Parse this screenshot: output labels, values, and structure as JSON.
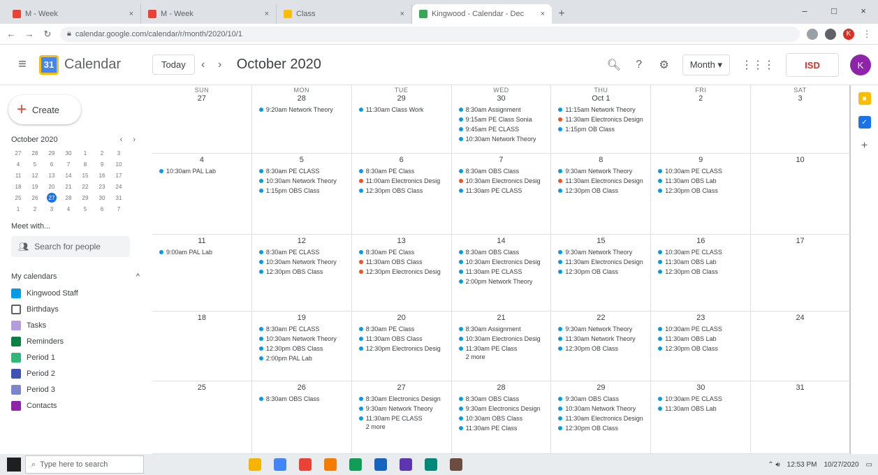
{
  "browser": {
    "tabs": [
      {
        "label": "M - Week",
        "color": "#ea4335",
        "active": false
      },
      {
        "label": "M - Week",
        "color": "#ea4335",
        "active": false
      },
      {
        "label": "Class",
        "color": "#fbbc04",
        "active": false
      },
      {
        "label": "Kingwood - Calendar - Dec",
        "color": "#34a853",
        "active": true
      }
    ],
    "new_tab": "+",
    "url": "calendar.google.com/calendar/r/month/2020/10/1",
    "window_controls": [
      "–",
      "□",
      "×"
    ]
  },
  "header": {
    "app_name": "Calendar",
    "logo_text": "31",
    "today_label": "Today",
    "prev": "‹",
    "next": "›",
    "month_title": "October 2020",
    "view_label": "Month ▾",
    "brand_text": "ISD",
    "avatar_letter": "K",
    "icons": {
      "search": "search-icon",
      "help": "help-icon",
      "settings": "gear-icon",
      "apps": "apps-grid-icon"
    }
  },
  "sidebar": {
    "create_label": "Create",
    "mini_title": "October 2020",
    "mini_arrows": "‹ ›",
    "mini_days": [
      "27",
      "28",
      "29",
      "30",
      "1",
      "2",
      "3",
      "4",
      "5",
      "6",
      "7",
      "8",
      "9",
      "10",
      "11",
      "12",
      "13",
      "14",
      "15",
      "16",
      "17",
      "18",
      "19",
      "20",
      "21",
      "22",
      "23",
      "24",
      "25",
      "26",
      "27",
      "28",
      "29",
      "30",
      "31",
      "1",
      "2",
      "3",
      "4",
      "5",
      "6",
      "7"
    ],
    "meet_label": "Meet with...",
    "search_people": "Search for people",
    "my_calendars": "My calendars",
    "collapse": "^",
    "calendars": [
      {
        "label": "Kingwood Staff",
        "color": "#039be5",
        "checked": true
      },
      {
        "label": "Birthdays",
        "color": "#616161",
        "checked": false
      },
      {
        "label": "Tasks",
        "color": "#b39ddb",
        "checked": true
      },
      {
        "label": "Reminders",
        "color": "#0b8043",
        "checked": true
      },
      {
        "label": "Period 1",
        "color": "#33b679",
        "checked": true
      },
      {
        "label": "Period 2",
        "color": "#3f51b5",
        "checked": true
      },
      {
        "label": "Period 3",
        "color": "#7986cb",
        "checked": true
      },
      {
        "label": "Contacts",
        "color": "#8e24aa",
        "checked": true
      }
    ]
  },
  "calendar": {
    "dow": [
      "SUN",
      "MON",
      "TUE",
      "WED",
      "THU",
      "FRI",
      "SAT"
    ],
    "weeks": [
      [
        {
          "day": "27",
          "events": []
        },
        {
          "day": "28",
          "events": [
            {
              "t": "9:20am Network Theory",
              "c": "#039be5"
            }
          ]
        },
        {
          "day": "29",
          "events": [
            {
              "t": "11:30am Class Work",
              "c": "#039be5"
            }
          ]
        },
        {
          "day": "30",
          "events": [
            {
              "t": "8:30am Assignment",
              "c": "#039be5"
            },
            {
              "t": "9:15am PE Class Sonia",
              "c": "#039be5"
            },
            {
              "t": "9:45am PE CLASS",
              "c": "#039be5"
            },
            {
              "t": "10:30am Network Theory",
              "c": "#039be5"
            }
          ]
        },
        {
          "day": "Oct 1",
          "events": [
            {
              "t": "11:15am Network Theory",
              "c": "#039be5"
            },
            {
              "t": "11:30am Electronics Design",
              "c": "#f4511e"
            },
            {
              "t": "1:15pm OB Class",
              "c": "#039be5"
            }
          ]
        },
        {
          "day": "2",
          "events": []
        },
        {
          "day": "3",
          "events": []
        }
      ],
      [
        {
          "day": "4",
          "events": [
            {
              "t": "10:30am PAL Lab",
              "c": "#039be5"
            }
          ]
        },
        {
          "day": "5",
          "events": [
            {
              "t": "8:30am PE CLASS",
              "c": "#039be5"
            },
            {
              "t": "10:30am Network Theory",
              "c": "#039be5"
            },
            {
              "t": "1:15pm OBS Class",
              "c": "#039be5"
            }
          ]
        },
        {
          "day": "6",
          "events": [
            {
              "t": "8:30am PE Class",
              "c": "#039be5"
            },
            {
              "t": "11:00am Electronics Desig",
              "c": "#f4511e"
            },
            {
              "t": "12:30pm OBS Class",
              "c": "#039be5"
            }
          ]
        },
        {
          "day": "7",
          "events": [
            {
              "t": "8:30am OBS Class",
              "c": "#039be5"
            },
            {
              "t": "10:30am Electronics Desig",
              "c": "#f4511e"
            },
            {
              "t": "11:30am PE CLASS",
              "c": "#039be5"
            }
          ]
        },
        {
          "day": "8",
          "events": [
            {
              "t": "9:30am Network Theory",
              "c": "#039be5"
            },
            {
              "t": "11:30am Electronics Design",
              "c": "#f4511e"
            },
            {
              "t": "12:30pm OB Class",
              "c": "#039be5"
            }
          ]
        },
        {
          "day": "9",
          "events": [
            {
              "t": "10:30am PE CLASS",
              "c": "#039be5"
            },
            {
              "t": "11:30am OBS Lab",
              "c": "#039be5"
            },
            {
              "t": "12:30pm OB Class",
              "c": "#039be5"
            }
          ]
        },
        {
          "day": "10",
          "events": []
        }
      ],
      [
        {
          "day": "11",
          "events": [
            {
              "t": "9:00am PAL Lab",
              "c": "#039be5"
            }
          ]
        },
        {
          "day": "12",
          "events": [
            {
              "t": "8:30am PE CLASS",
              "c": "#039be5"
            },
            {
              "t": "10:30am Network Theory",
              "c": "#039be5"
            },
            {
              "t": "12:30pm OBS Class",
              "c": "#039be5"
            }
          ]
        },
        {
          "day": "13",
          "events": [
            {
              "t": "8:30am PE Class",
              "c": "#039be5"
            },
            {
              "t": "11:30am OBS Class",
              "c": "#f4511e"
            },
            {
              "t": "12:30pm Electronics Desig",
              "c": "#f4511e"
            }
          ]
        },
        {
          "day": "14",
          "events": [
            {
              "t": "8:30am OBS Class",
              "c": "#039be5"
            },
            {
              "t": "10:30am Electronics Desig",
              "c": "#039be5"
            },
            {
              "t": "11:30am PE CLASS",
              "c": "#039be5"
            },
            {
              "t": "2:00pm Network Theory",
              "c": "#039be5"
            }
          ]
        },
        {
          "day": "15",
          "events": [
            {
              "t": "9:30am Network Theory",
              "c": "#039be5"
            },
            {
              "t": "11:30am Electronics Design",
              "c": "#039be5"
            },
            {
              "t": "12:30pm OB Class",
              "c": "#039be5"
            }
          ]
        },
        {
          "day": "16",
          "events": [
            {
              "t": "10:30am PE CLASS",
              "c": "#039be5"
            },
            {
              "t": "11:30am OBS Lab",
              "c": "#039be5"
            },
            {
              "t": "12:30pm OB Class",
              "c": "#039be5"
            }
          ]
        },
        {
          "day": "17",
          "events": []
        }
      ],
      [
        {
          "day": "18",
          "events": []
        },
        {
          "day": "19",
          "events": [
            {
              "t": "8:30am PE CLASS",
              "c": "#039be5"
            },
            {
              "t": "10:30am Network Theory",
              "c": "#039be5"
            },
            {
              "t": "12:30pm OBS Class",
              "c": "#039be5"
            },
            {
              "t": "2:00pm PAL Lab",
              "c": "#039be5"
            }
          ]
        },
        {
          "day": "20",
          "events": [
            {
              "t": "8:30am PE Class",
              "c": "#039be5"
            },
            {
              "t": "11:30am OBS Class",
              "c": "#039be5"
            },
            {
              "t": "12:30pm Electronics Desig",
              "c": "#039be5"
            }
          ]
        },
        {
          "day": "21",
          "events": [
            {
              "t": "8:30am Assignment",
              "c": "#039be5"
            },
            {
              "t": "10:30am Electronics Desig",
              "c": "#039be5"
            },
            {
              "t": "11:30am PE Class",
              "c": "#039be5"
            }
          ],
          "extra": "2 more"
        },
        {
          "day": "22",
          "events": [
            {
              "t": "9:30am Network Theory",
              "c": "#039be5"
            },
            {
              "t": "11:30am Network Theory",
              "c": "#039be5"
            },
            {
              "t": "12:30pm OB Class",
              "c": "#039be5"
            }
          ]
        },
        {
          "day": "23",
          "events": [
            {
              "t": "10:30am PE CLASS",
              "c": "#039be5"
            },
            {
              "t": "11:30am OBS Lab",
              "c": "#039be5"
            },
            {
              "t": "12:30pm OB Class",
              "c": "#039be5"
            }
          ]
        },
        {
          "day": "24",
          "events": []
        }
      ],
      [
        {
          "day": "25",
          "events": []
        },
        {
          "day": "26",
          "events": [
            {
              "t": "8:30am OBS Class",
              "c": "#039be5"
            }
          ]
        },
        {
          "day": "27",
          "events": [
            {
              "t": "8:30am Electronics Design",
              "c": "#039be5"
            },
            {
              "t": "9:30am Network Theory",
              "c": "#039be5"
            },
            {
              "t": "11:30am PE CLASS",
              "c": "#039be5"
            }
          ],
          "extra": "2 more"
        },
        {
          "day": "28",
          "events": [
            {
              "t": "8:30am OBS Class",
              "c": "#039be5"
            },
            {
              "t": "9:30am Electronics Design",
              "c": "#039be5"
            },
            {
              "t": "10:30am OBS Class",
              "c": "#039be5"
            },
            {
              "t": "11:30am PE Class",
              "c": "#039be5"
            }
          ]
        },
        {
          "day": "29",
          "events": [
            {
              "t": "9:30am OBS Class",
              "c": "#039be5"
            },
            {
              "t": "10:30am Network Theory",
              "c": "#039be5"
            },
            {
              "t": "11:30am Electronics Design",
              "c": "#039be5"
            },
            {
              "t": "12:30pm OB Class",
              "c": "#039be5"
            }
          ]
        },
        {
          "day": "30",
          "events": [
            {
              "t": "10:30am PE CLASS",
              "c": "#039be5"
            },
            {
              "t": "11:30am OBS Lab",
              "c": "#039be5"
            }
          ]
        },
        {
          "day": "31",
          "events": []
        }
      ]
    ]
  },
  "rail": {
    "icons": [
      {
        "name": "keep-icon",
        "color": "#fbbc04",
        "glyph": "■"
      },
      {
        "name": "tasks-icon",
        "color": "#1a73e8",
        "glyph": "✓"
      }
    ],
    "plus": "+"
  },
  "taskbar": {
    "search_placeholder": "Type here to search",
    "apps": [
      "#f4b400",
      "#4285f4",
      "#ea4335",
      "#f57c00",
      "#0f9d58",
      "#1565c0",
      "#5e35b1",
      "#00897b",
      "#6d4c41"
    ],
    "time": "12:53 PM",
    "date": "10/27/2020"
  }
}
